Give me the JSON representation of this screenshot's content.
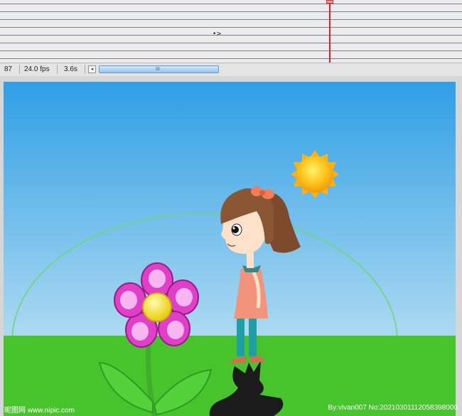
{
  "timeline": {
    "keyframe_marker": "•>"
  },
  "statusbar": {
    "frame": "87",
    "fps": "24.0 fps",
    "elapsed": "3.6s",
    "scroll_left_glyph": "◂",
    "scroll_grip": "III"
  },
  "stage": {
    "sky_top_color": "#2f9fe6",
    "sky_bottom_color": "#d4ecf4",
    "grass_color": "#47c42b",
    "sun_color": "#ffc21a",
    "arc_color": "#6bd86b",
    "flower_petal_color": "#e040c8",
    "flower_center_color": "#f5e31a"
  },
  "watermark": {
    "left": "昵图网 www.nipic.com",
    "right": "By:vivan007 No:20210301112058398000"
  }
}
